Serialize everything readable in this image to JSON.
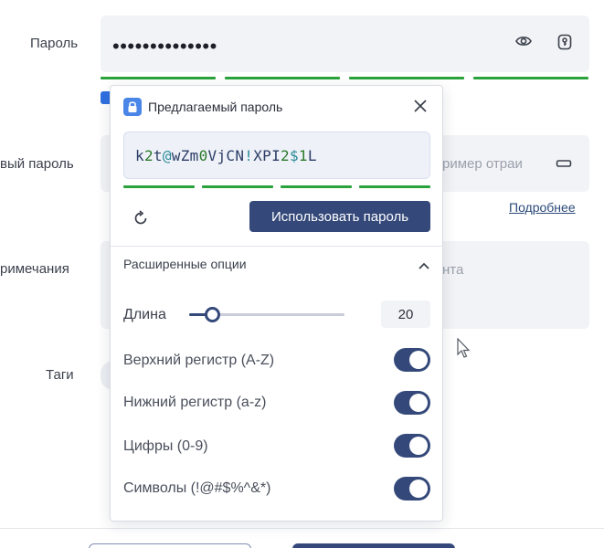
{
  "form": {
    "password_label": "Пароль",
    "password_value": "••••••••••••••",
    "new_password_label": "вый пароль",
    "new_password_placeholder": "ример отраи",
    "notes_label": "римечания",
    "notes_placeholder": "нта",
    "tags_label": "Таги",
    "more_link": "Подробнее"
  },
  "generator": {
    "title": "Предлагаемый пароль",
    "password_parts": [
      {
        "t": "k",
        "k": "low"
      },
      {
        "t": "2",
        "k": "digit"
      },
      {
        "t": "t",
        "k": "low"
      },
      {
        "t": "@",
        "k": "sym"
      },
      {
        "t": "w",
        "k": "low"
      },
      {
        "t": "Z",
        "k": "up"
      },
      {
        "t": "m",
        "k": "low"
      },
      {
        "t": "0",
        "k": "digit"
      },
      {
        "t": "V",
        "k": "up"
      },
      {
        "t": "j",
        "k": "low"
      },
      {
        "t": "C",
        "k": "up"
      },
      {
        "t": "N",
        "k": "up"
      },
      {
        "t": "!",
        "k": "sym"
      },
      {
        "t": "X",
        "k": "up"
      },
      {
        "t": "P",
        "k": "up"
      },
      {
        "t": "I",
        "k": "up"
      },
      {
        "t": "2",
        "k": "digit"
      },
      {
        "t": "$",
        "k": "sym"
      },
      {
        "t": "1",
        "k": "digit"
      },
      {
        "t": "L",
        "k": "up"
      }
    ],
    "use_button": "Использовать пароль",
    "advanced_title": "Расширенные опции",
    "length_label": "Длина",
    "length_value": "20",
    "length_fraction": 0.15,
    "options": [
      {
        "label": "Верхний регистр (A-Z)",
        "on": true
      },
      {
        "label": "Нижний регистр (a-z)",
        "on": true
      },
      {
        "label": "Цифры (0-9)",
        "on": true
      },
      {
        "label": "Символы (!@#$%^&*)",
        "on": true
      }
    ]
  },
  "colors": {
    "accent": "#34497a",
    "strength": "#2aa33c",
    "digit": "#2b7a2b",
    "symbol": "#2a8a9a"
  },
  "icons": {
    "show_password": "eye-icon",
    "generator": "key-generator-icon",
    "copy": "copy-icon",
    "close": "close-icon",
    "refresh": "refresh-icon",
    "collapse": "chevron-up-icon",
    "logo": "lock-logo-icon"
  }
}
